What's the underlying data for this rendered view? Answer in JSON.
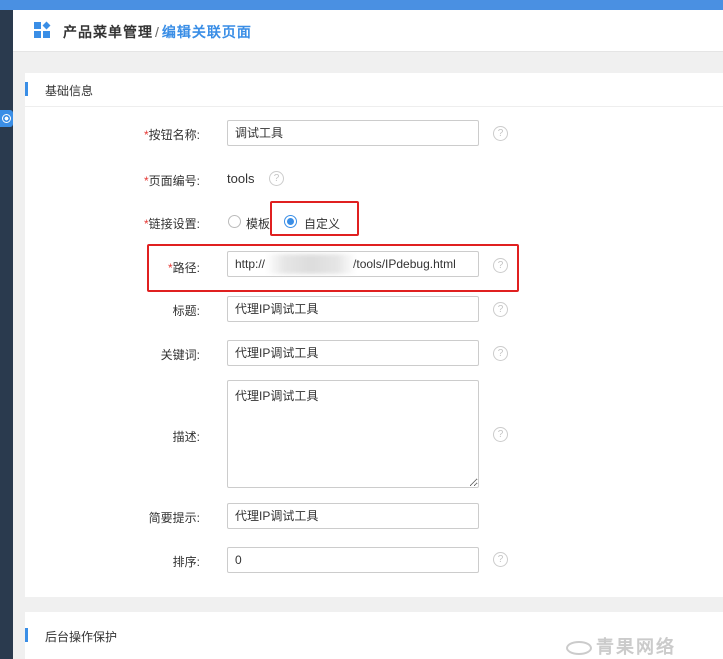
{
  "breadcrumb": {
    "parent": "产品菜单管理",
    "separator": "/",
    "current": "编辑关联页面"
  },
  "section_basic": {
    "title": "基础信息"
  },
  "section_protect": {
    "title": "后台操作保护"
  },
  "form": {
    "required_mark": "*",
    "help_glyph": "?",
    "button_name": {
      "label": "按钮名称:",
      "value": "调试工具"
    },
    "page_code": {
      "label": "页面编号:",
      "value": "tools"
    },
    "link_setting": {
      "label": "链接设置:",
      "options": [
        "模板",
        "自定义"
      ],
      "selected": "自定义"
    },
    "path": {
      "label": "路径:",
      "value_prefix": "http://",
      "value_suffix": "/tools/IPdebug.html"
    },
    "title": {
      "label": "标题:",
      "value": "代理IP调试工具"
    },
    "keywords": {
      "label": "关键词:",
      "value": "代理IP调试工具"
    },
    "description": {
      "label": "描述:",
      "value": "代理IP调试工具"
    },
    "brief_hint": {
      "label": "简要提示:",
      "value": "代理IP调试工具"
    },
    "sort": {
      "label": "排序:",
      "value": "0"
    }
  },
  "watermark": {
    "text": "青果网络"
  },
  "colors": {
    "accent": "#3a8ee6",
    "highlight_box": "#e02020",
    "required": "#e53935"
  }
}
